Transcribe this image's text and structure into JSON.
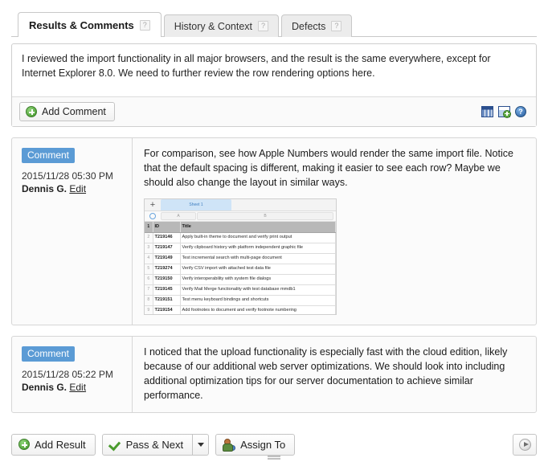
{
  "tabs": [
    {
      "label": "Results & Comments",
      "help": "?",
      "active": true
    },
    {
      "label": "History & Context",
      "help": "?",
      "active": false
    },
    {
      "label": "Defects",
      "help": "?",
      "active": false
    }
  ],
  "editor": {
    "value": "I reviewed the import functionality in all major browsers, and the result is the same everywhere, except for Internet Explorer 8.0. We need to further review the row rendering options here.",
    "placeholder": "",
    "add_comment_label": "Add Comment",
    "tool_icons": [
      {
        "name": "insert-table-icon",
        "glyph": ""
      },
      {
        "name": "attach-image-icon",
        "glyph": ""
      },
      {
        "name": "help-icon",
        "glyph": "?"
      }
    ]
  },
  "comments": [
    {
      "badge": "Comment",
      "date": "2015/11/28 05:30 PM",
      "author": "Dennis G.",
      "edit_label": "Edit",
      "text": "For comparison, see how Apple Numbers would render the same import file. Notice that the default spacing is different, making it easier to see each row? Maybe we should also change the layout in similar ways.",
      "attachment": {
        "type": "spreadsheet-screenshot",
        "plus_label": "+",
        "sheet_tab": "Sheet 1",
        "column_letters": [
          "A",
          "B"
        ],
        "headers": [
          "ID",
          "Title"
        ],
        "rows": [
          {
            "n": "2",
            "id": "T219146",
            "title": "Apply built-in theme to document and verify print output"
          },
          {
            "n": "3",
            "id": "T219147",
            "title": "Verify clipboard history with platform independent graphic file"
          },
          {
            "n": "4",
            "id": "T219149",
            "title": "Test incremental search with multi-page document"
          },
          {
            "n": "5",
            "id": "T219274",
            "title": "Verify CSV import with attached test data file"
          },
          {
            "n": "6",
            "id": "T219150",
            "title": "Verify interoperability with system file dialogs"
          },
          {
            "n": "7",
            "id": "T219145",
            "title": "Verify Mail Merge functionality with test database mmdb1"
          },
          {
            "n": "8",
            "id": "T219151",
            "title": "Test menu keyboard bindings and shortcuts"
          },
          {
            "n": "9",
            "id": "T219154",
            "title": "Add footnotes to document and verify footnote numbering"
          }
        ],
        "header_row_number": "1"
      }
    },
    {
      "badge": "Comment",
      "date": "2015/11/28 05:22 PM",
      "author": "Dennis G.",
      "edit_label": "Edit",
      "text": "I noticed that the upload functionality is especially fast with the cloud edition, likely because of our additional web server optimizations. We should look into including additional optimization tips for our server documentation to achieve similar performance.",
      "attachment": null
    }
  ],
  "bottom_bar": {
    "add_result_label": "Add Result",
    "pass_next_label": "Pass & Next",
    "assign_to_label": "Assign To",
    "next_icon": "next-arrow-icon"
  },
  "colors": {
    "badge_blue": "#5b9bd5",
    "icon_green": "#57a83f",
    "icon_blue": "#2b4f8e",
    "sheet_tab_blue": "#cfe4f7",
    "border_gray": "#cfcfcf"
  }
}
